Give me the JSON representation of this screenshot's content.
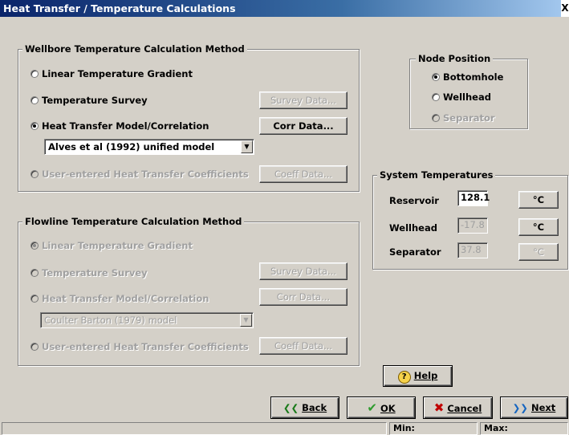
{
  "window": {
    "title": "Heat Transfer / Temperature Calculations",
    "close_glyph": "X"
  },
  "wellbore": {
    "legend": "Wellbore Temperature Calculation Method",
    "opt_linear": "Linear Temperature Gradient",
    "opt_survey": "Temperature Survey",
    "opt_model": "Heat Transfer Model/Correlation",
    "opt_user": "User-entered Heat Transfer Coefficients",
    "btn_survey": "Survey Data...",
    "btn_corr": "Corr Data...",
    "btn_coeff": "Coeff Data...",
    "model_value": "Alves et al (1992) unified model"
  },
  "flowline": {
    "legend": "Flowline Temperature Calculation Method",
    "opt_linear": "Linear Temperature Gradient",
    "opt_survey": "Temperature Survey",
    "opt_model": "Heat Transfer Model/Correlation",
    "opt_user": "User-entered Heat Transfer Coefficients",
    "btn_survey": "Survey Data...",
    "btn_corr": "Corr Data...",
    "btn_coeff": "Coeff Data...",
    "model_value": "Coulter Barton (1979) model"
  },
  "node": {
    "legend": "Node Position",
    "bottomhole": "Bottomhole",
    "wellhead": "Wellhead",
    "separator": "Separator"
  },
  "system": {
    "legend": "System Temperatures",
    "reservoir_label": "Reservoir",
    "reservoir_value": "128.1",
    "wellhead_label": "Wellhead",
    "wellhead_value": "-17.8",
    "separator_label": "Separator",
    "separator_value": "37.8",
    "unit": "°C"
  },
  "buttons": {
    "help": "Help",
    "back": "Back",
    "ok": "OK",
    "cancel": "Cancel",
    "next": "Next"
  },
  "status": {
    "min": "Min:",
    "max": "Max:"
  }
}
